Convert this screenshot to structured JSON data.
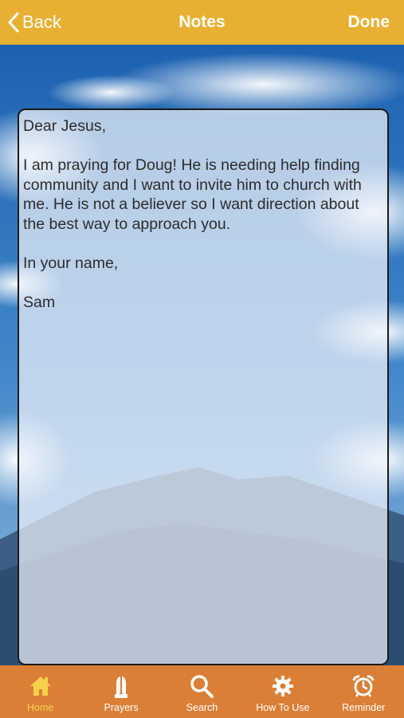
{
  "colors": {
    "navbar_bg": "#e8b033",
    "tabbar_bg": "#db7f36",
    "active_tab": "#f5d24a",
    "inactive_tab": "#ffffff"
  },
  "nav": {
    "back_label": "Back",
    "title": "Notes",
    "done_label": "Done",
    "back_icon": "chevron-left-icon"
  },
  "note": {
    "text": "Dear Jesus,\n\nI am praying for Doug! He is needing help finding community and I want to invite him to church with me. He is not a believer so I want direction about the best way to approach you.\n\nIn your name,\n\nSam"
  },
  "tabs": [
    {
      "label": "Home",
      "icon": "home-icon",
      "active": true
    },
    {
      "label": "Prayers",
      "icon": "praying-hands-icon",
      "active": false
    },
    {
      "label": "Search",
      "icon": "search-icon",
      "active": false
    },
    {
      "label": "How To Use",
      "icon": "gear-icon",
      "active": false
    },
    {
      "label": "Reminder",
      "icon": "alarm-clock-icon",
      "active": false
    }
  ]
}
